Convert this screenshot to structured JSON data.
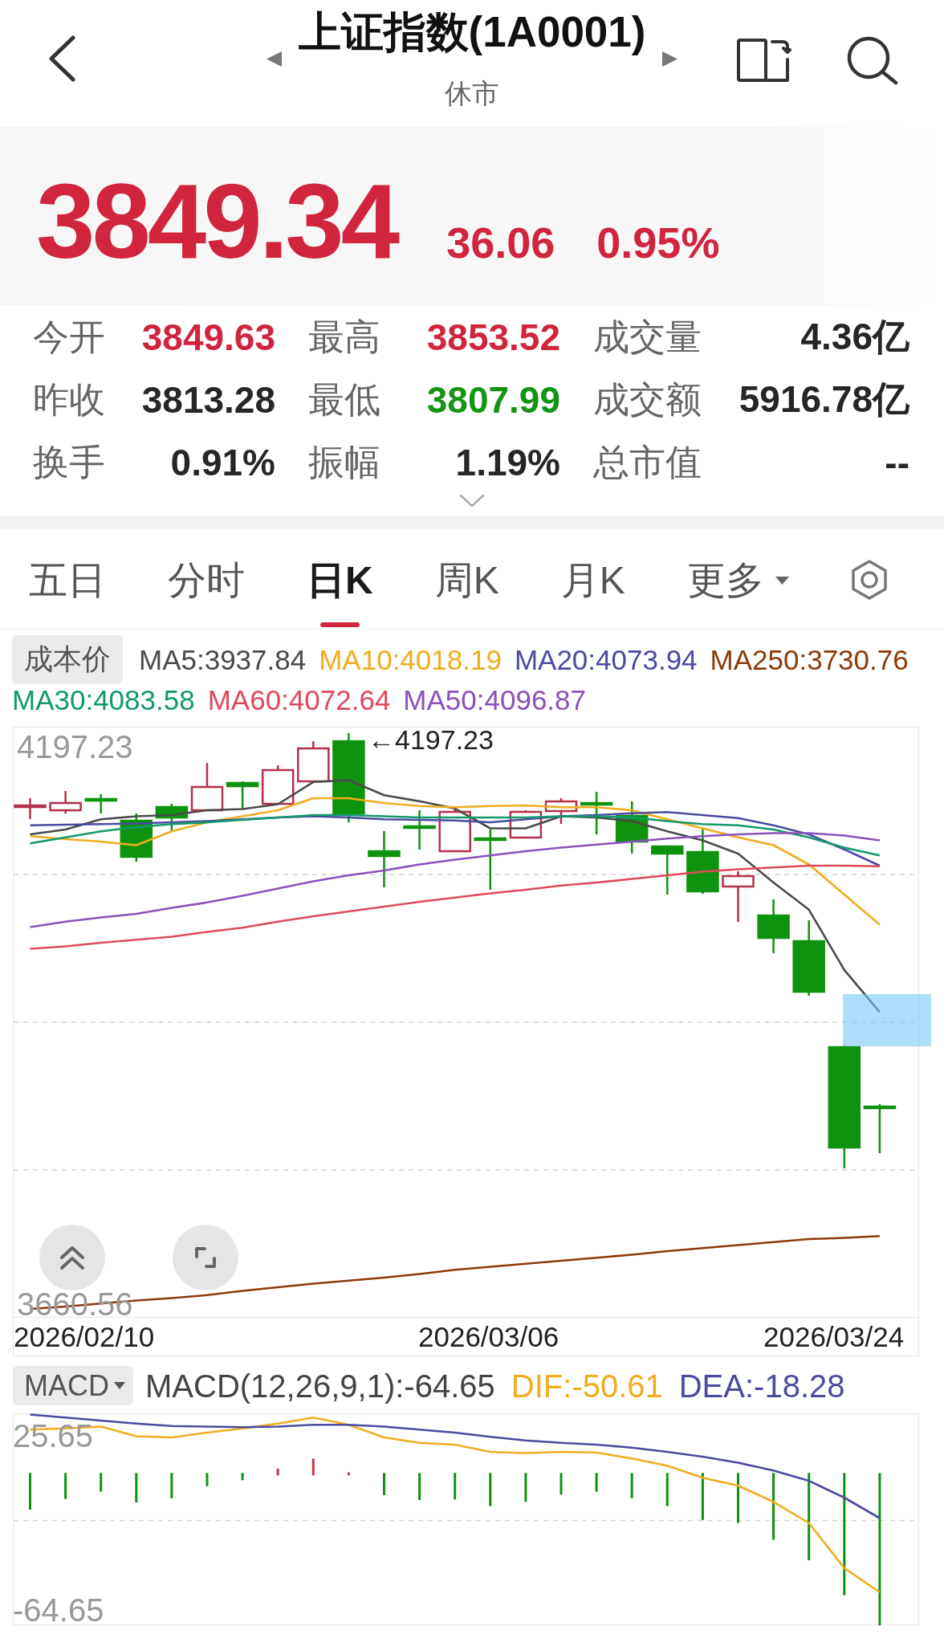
{
  "header": {
    "title": "上证指数(1A0001)",
    "status": "休市"
  },
  "quote": {
    "price": "3849.34",
    "change": "36.06",
    "change_percent": "0.95%",
    "rising": true
  },
  "stats": [
    {
      "label": "今开",
      "value": "3849.63",
      "color": "#d0243f"
    },
    {
      "label": "最高",
      "value": "3853.52",
      "color": "#d0243f"
    },
    {
      "label": "成交量",
      "value": "4.36亿",
      "color": "#262626"
    },
    {
      "label": "昨收",
      "value": "3813.28",
      "color": "#262626"
    },
    {
      "label": "最低",
      "value": "3807.99",
      "color": "#169416"
    },
    {
      "label": "成交额",
      "value": "5916.78亿",
      "color": "#262626"
    },
    {
      "label": "换手",
      "value": "0.91%",
      "color": "#262626"
    },
    {
      "label": "振幅",
      "value": "1.19%",
      "color": "#262626"
    },
    {
      "label": "总市值",
      "value": "--",
      "color": "#262626"
    }
  ],
  "period_tabs": [
    {
      "label": "五日",
      "selected": false,
      "kind": "tab"
    },
    {
      "label": "分时",
      "selected": false,
      "kind": "tab"
    },
    {
      "label": "日K",
      "selected": true,
      "kind": "tab"
    },
    {
      "label": "周K",
      "selected": false,
      "kind": "tab"
    },
    {
      "label": "月K",
      "selected": false,
      "kind": "tab"
    },
    {
      "label": "更多",
      "selected": false,
      "kind": "menu"
    }
  ],
  "ma_legend": {
    "chip": "成本价",
    "items": [
      {
        "text": "MA5:3937.84",
        "color": "#4a4a4a"
      },
      {
        "text": "MA10:4018.19",
        "color": "#f0ad1e"
      },
      {
        "text": "MA20:4073.94",
        "color": "#4b4ba0"
      },
      {
        "text": "MA250:3730.76",
        "color": "#8c3a0c"
      },
      {
        "text": "MA30:4083.58",
        "color": "#13996b"
      },
      {
        "text": "MA60:4072.64",
        "color": "#de4a5c"
      },
      {
        "text": "MA50:4096.87",
        "color": "#8a52bb"
      }
    ]
  },
  "kline_chart": {
    "top_label": "4197.23",
    "bottom_label": "3660.56",
    "peak_label": "←4197.23",
    "dates": [
      "2026/02/10",
      "2026/03/06",
      "2026/03/24"
    ]
  },
  "indicator": {
    "selector": "MACD",
    "reading": "MACD(12,26,9,1):-64.65",
    "lines": [
      {
        "text": "DIF:-50.61",
        "color": "#f0ad1e"
      },
      {
        "text": "DEA:-18.28",
        "color": "#4b4ba0"
      }
    ],
    "top_label": "25.65",
    "bottom_label": "-64.65"
  }
}
